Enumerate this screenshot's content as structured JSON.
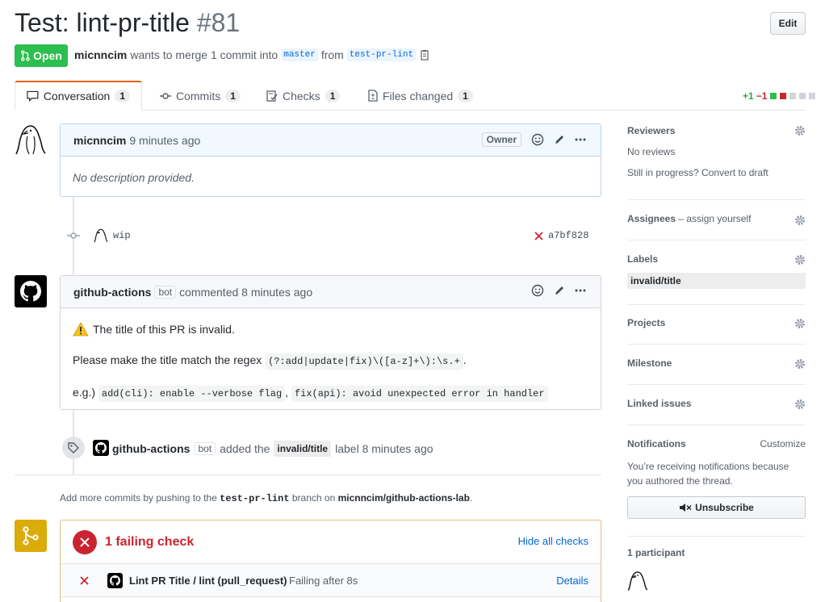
{
  "header": {
    "title": "Test: lint-pr-title",
    "number": "#81",
    "edit_label": "Edit",
    "state": "Open",
    "author": "micnncim",
    "merge_text_1": "wants to merge 1 commit into",
    "base_branch": "master",
    "merge_text_2": "from",
    "head_branch": "test-pr-lint"
  },
  "tabs": [
    {
      "label": "Conversation",
      "count": "1"
    },
    {
      "label": "Commits",
      "count": "1"
    },
    {
      "label": "Checks",
      "count": "1"
    },
    {
      "label": "Files changed",
      "count": "1"
    }
  ],
  "diffstat": {
    "additions": "+1",
    "deletions": "−1"
  },
  "comment1": {
    "author": "micnncim",
    "time": "9 minutes ago",
    "role": "Owner",
    "body": "No description provided."
  },
  "commit": {
    "message": "wip",
    "sha": "a7bf828"
  },
  "comment2": {
    "author": "github-actions",
    "bot": "bot",
    "action": "commented 8 minutes ago",
    "line1": "The title of this PR is invalid.",
    "line2_prefix": "Please make the title match the regex",
    "regex": "(?:add|update|fix)\\([a-z]+\\):\\s.+",
    "line2_suffix": ".",
    "line3_prefix": "e.g.)",
    "example1": "add(cli): enable --verbose flag",
    "sep": ",",
    "example2": "fix(api): avoid unexpected error in handler"
  },
  "label_event": {
    "author": "github-actions",
    "bot": "bot",
    "text1": "added the",
    "label": "invalid/title",
    "text2": "label 8 minutes ago"
  },
  "push_hint": {
    "prefix": "Add more commits by pushing to the",
    "branch": "test-pr-lint",
    "middle": "branch on",
    "repo": "micnncim/github-actions-lab",
    "suffix": "."
  },
  "checks": {
    "summary": "1 failing check",
    "hide_label": "Hide all checks",
    "item_name": "Lint PR Title / lint (pull_request)",
    "item_status": "Failing after 8s",
    "details_label": "Details"
  },
  "sidebar": {
    "reviewers_title": "Reviewers",
    "reviewers_value": "No reviews",
    "draft_text": "Still in progress? Convert to draft",
    "assignees_title": "Assignees",
    "assignees_link": "– assign yourself",
    "labels_title": "Labels",
    "label_value": "invalid/title",
    "projects_title": "Projects",
    "milestone_title": "Milestone",
    "linked_title": "Linked issues",
    "notifications_title": "Notifications",
    "customize_label": "Customize",
    "notifications_text": "You’re receiving notifications because you authored the thread.",
    "unsubscribe_label": "Unsubscribe",
    "participants": "1 participant"
  },
  "colors": {
    "open_green": "#2cbe4e",
    "fail_red": "#cb2431",
    "link_blue": "#0366d6"
  }
}
